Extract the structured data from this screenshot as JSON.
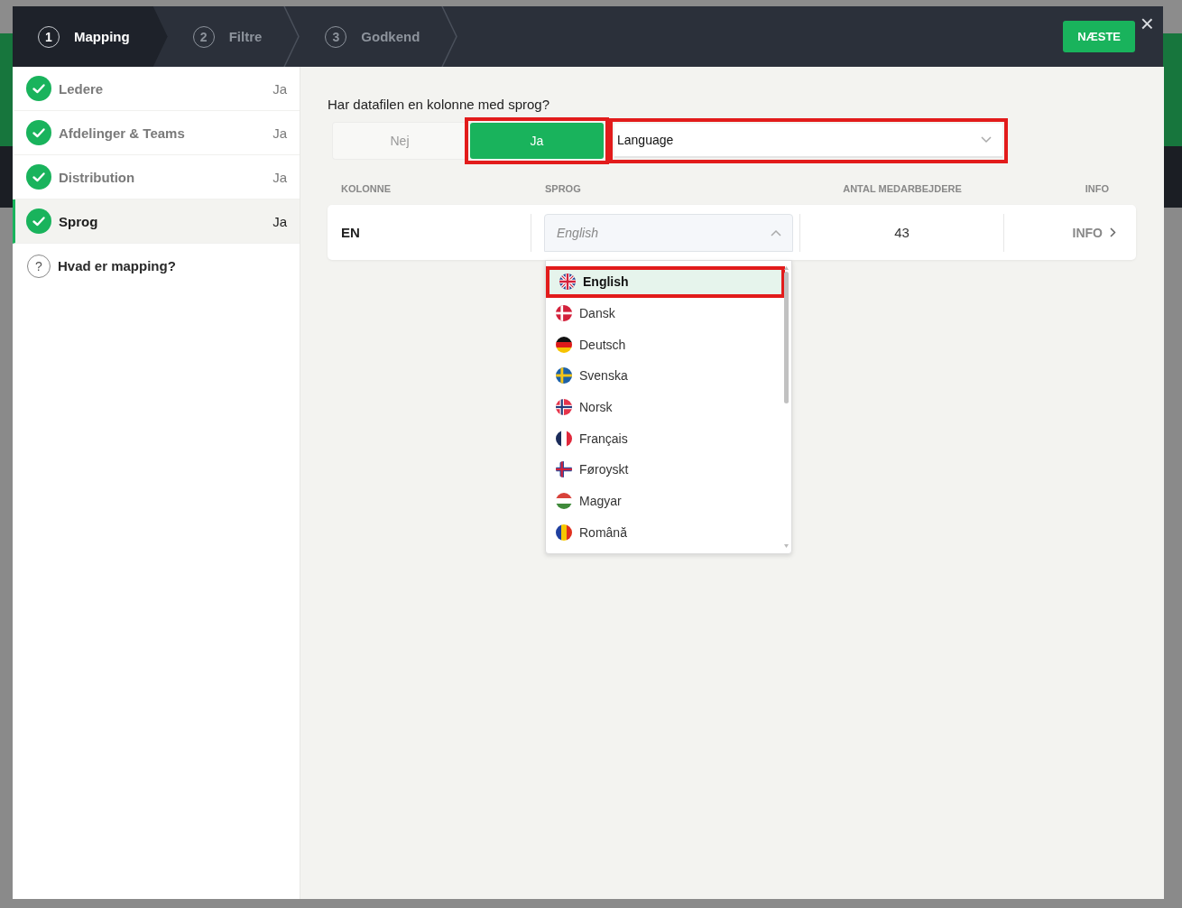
{
  "steps": [
    {
      "number": "1",
      "label": "Mapping",
      "selected": true
    },
    {
      "number": "2",
      "label": "Filtre",
      "selected": false
    },
    {
      "number": "3",
      "label": "Godkend",
      "selected": false
    }
  ],
  "next_button": "NÆSTE",
  "close": "×",
  "sidebar": {
    "items": [
      {
        "label": "Ledere",
        "value": "Ja",
        "done": true,
        "selected": false
      },
      {
        "label": "Afdelinger & Teams",
        "value": "Ja",
        "done": true,
        "selected": false
      },
      {
        "label": "Distribution",
        "value": "Ja",
        "done": true,
        "selected": false
      },
      {
        "label": "Sprog",
        "value": "Ja",
        "done": true,
        "selected": true
      }
    ],
    "help": {
      "icon": "?",
      "label": "Hvad er mapping?"
    }
  },
  "question": "Har datafilen en kolonne med sprog?",
  "toggle": [
    {
      "label": "Nej",
      "selected": false,
      "highlighted": false
    },
    {
      "label": "Ja",
      "selected": true,
      "highlighted": true
    }
  ],
  "column_select": {
    "value": "Language",
    "highlighted": true
  },
  "table": {
    "columns": [
      "KOLONNE",
      "SPROG",
      "ANTAL MEDARBEJDERE",
      "INFO"
    ],
    "rows": [
      {
        "kolonne": "EN",
        "sprog": {
          "placeholder": "English",
          "expanded": true
        },
        "antal": "43",
        "info": "INFO"
      }
    ]
  },
  "dropdown": {
    "options": [
      {
        "label": "English",
        "kind": "uk",
        "selected": true,
        "highlighted": true
      },
      {
        "label": "Dansk",
        "kind": "dk",
        "selected": false,
        "highlighted": false
      },
      {
        "label": "Deutsch",
        "kind": "de",
        "selected": false,
        "highlighted": false
      },
      {
        "label": "Svenska",
        "kind": "se",
        "selected": false,
        "highlighted": false
      },
      {
        "label": "Norsk",
        "kind": "no",
        "selected": false,
        "highlighted": false
      },
      {
        "label": "Français",
        "kind": "fr",
        "selected": false,
        "highlighted": false
      },
      {
        "label": "Føroyskt",
        "kind": "fo",
        "selected": false,
        "highlighted": false
      },
      {
        "label": "Magyar",
        "kind": "hu",
        "selected": false,
        "highlighted": false
      },
      {
        "label": "Română",
        "kind": "ro",
        "selected": false,
        "highlighted": false
      }
    ]
  }
}
